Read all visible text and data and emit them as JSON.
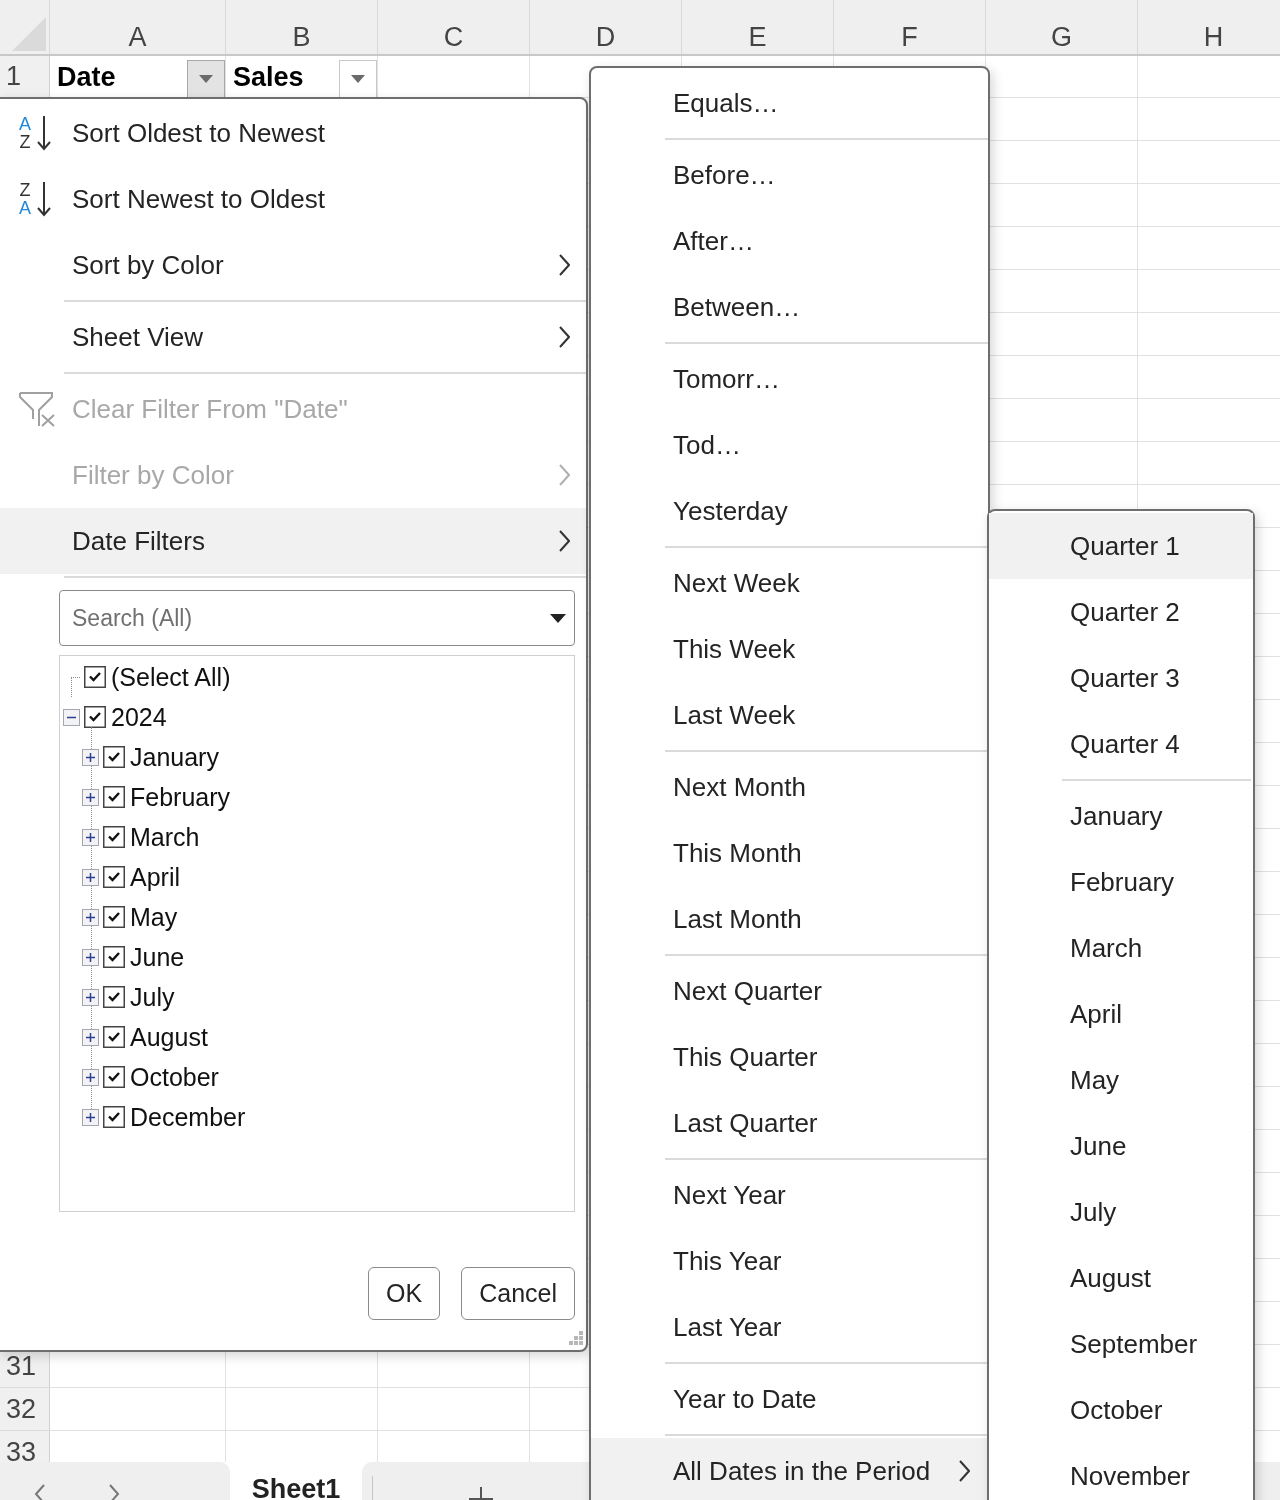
{
  "column_headers": [
    "A",
    "B",
    "C",
    "D",
    "E",
    "F",
    "G",
    "H"
  ],
  "rows": [
    {
      "number": "1",
      "cells": [
        {
          "text": "Date",
          "filter_open": true
        },
        {
          "text": "Sales",
          "filter_open": false
        }
      ]
    },
    {
      "number": "31"
    },
    {
      "number": "32"
    },
    {
      "number": "33"
    }
  ],
  "filter_menu": {
    "groups": [
      [
        {
          "label": "Sort Oldest to Newest",
          "kind": "sort_ascending",
          "icon_letters": [
            "A",
            "Z"
          ],
          "disabled": false,
          "highlighted": false
        },
        {
          "label": "Sort Newest to Oldest",
          "kind": "sort_descending",
          "icon_letters": [
            "Z",
            "A"
          ],
          "disabled": false,
          "highlighted": false
        },
        {
          "label": "Sort by Color",
          "kind": "submenu",
          "disabled": false,
          "highlighted": false
        }
      ],
      [
        {
          "label": "Sheet View",
          "kind": "submenu",
          "disabled": false,
          "highlighted": false
        }
      ],
      [
        {
          "label": "Clear Filter From \"Date\"",
          "kind": "clear_filter",
          "disabled": true,
          "highlighted": false
        },
        {
          "label": "Filter by Color",
          "kind": "submenu",
          "disabled": true,
          "highlighted": false
        },
        {
          "label": "Date Filters",
          "kind": "submenu",
          "disabled": false,
          "highlighted": true
        }
      ]
    ],
    "search": {
      "placeholder": "Search (All)"
    },
    "tree": [
      {
        "label": "(Select All)",
        "checked": true
      },
      {
        "label": "2024",
        "checked": true,
        "expanded": true,
        "children": [
          {
            "label": "January",
            "checked": true,
            "expanded": false
          },
          {
            "label": "February",
            "checked": true,
            "expanded": false
          },
          {
            "label": "March",
            "checked": true,
            "expanded": false
          },
          {
            "label": "April",
            "checked": true,
            "expanded": false
          },
          {
            "label": "May",
            "checked": true,
            "expanded": false
          },
          {
            "label": "June",
            "checked": true,
            "expanded": false
          },
          {
            "label": "July",
            "checked": true,
            "expanded": false
          },
          {
            "label": "August",
            "checked": true,
            "expanded": false
          },
          {
            "label": "October",
            "checked": true,
            "expanded": false
          },
          {
            "label": "December",
            "checked": true,
            "expanded": false
          }
        ]
      }
    ],
    "buttons": [
      "OK",
      "Cancel"
    ]
  },
  "date_filters_menu": {
    "groups": [
      [
        {
          "label": "Equals…",
          "submenu": false,
          "highlighted": false
        }
      ],
      [
        {
          "label": "Before…",
          "submenu": false,
          "highlighted": false
        },
        {
          "label": "After…",
          "submenu": false,
          "highlighted": false
        },
        {
          "label": "Between…",
          "submenu": false,
          "highlighted": false
        }
      ],
      [
        {
          "label": "Tomorr…",
          "submenu": false,
          "highlighted": false
        },
        {
          "label": "Tod…",
          "submenu": false,
          "highlighted": false
        },
        {
          "label": "Yesterday",
          "submenu": false,
          "highlighted": false
        }
      ],
      [
        {
          "label": "Next Week",
          "submenu": false,
          "highlighted": false
        },
        {
          "label": "This Week",
          "submenu": false,
          "highlighted": false
        },
        {
          "label": "Last Week",
          "submenu": false,
          "highlighted": false
        }
      ],
      [
        {
          "label": "Next Month",
          "submenu": false,
          "highlighted": false
        },
        {
          "label": "This Month",
          "submenu": false,
          "highlighted": false
        },
        {
          "label": "Last Month",
          "submenu": false,
          "highlighted": false
        }
      ],
      [
        {
          "label": "Next Quarter",
          "submenu": false,
          "highlighted": false
        },
        {
          "label": "This Quarter",
          "submenu": false,
          "highlighted": false
        },
        {
          "label": "Last Quarter",
          "submenu": false,
          "highlighted": false
        }
      ],
      [
        {
          "label": "Next Year",
          "submenu": false,
          "highlighted": false
        },
        {
          "label": "This Year",
          "submenu": false,
          "highlighted": false
        },
        {
          "label": "Last Year",
          "submenu": false,
          "highlighted": false
        }
      ],
      [
        {
          "label": "Year to Date",
          "submenu": false,
          "highlighted": false
        }
      ],
      [
        {
          "label": "All Dates in the Period",
          "submenu": true,
          "highlighted": true
        }
      ]
    ]
  },
  "period_submenu": {
    "groups": [
      [
        {
          "label": "Quarter 1",
          "highlighted": true
        },
        {
          "label": "Quarter 2",
          "highlighted": false
        },
        {
          "label": "Quarter 3",
          "highlighted": false
        },
        {
          "label": "Quarter 4",
          "highlighted": false
        }
      ],
      [
        {
          "label": "January",
          "highlighted": false
        },
        {
          "label": "February",
          "highlighted": false
        },
        {
          "label": "March",
          "highlighted": false
        },
        {
          "label": "April",
          "highlighted": false
        },
        {
          "label": "May",
          "highlighted": false
        },
        {
          "label": "June",
          "highlighted": false
        },
        {
          "label": "July",
          "highlighted": false
        },
        {
          "label": "August",
          "highlighted": false
        },
        {
          "label": "September",
          "highlighted": false
        },
        {
          "label": "October",
          "highlighted": false
        },
        {
          "label": "November",
          "highlighted": false
        }
      ]
    ]
  },
  "sheet_tabs": [
    {
      "label": "Sheet1",
      "selected": true
    }
  ]
}
